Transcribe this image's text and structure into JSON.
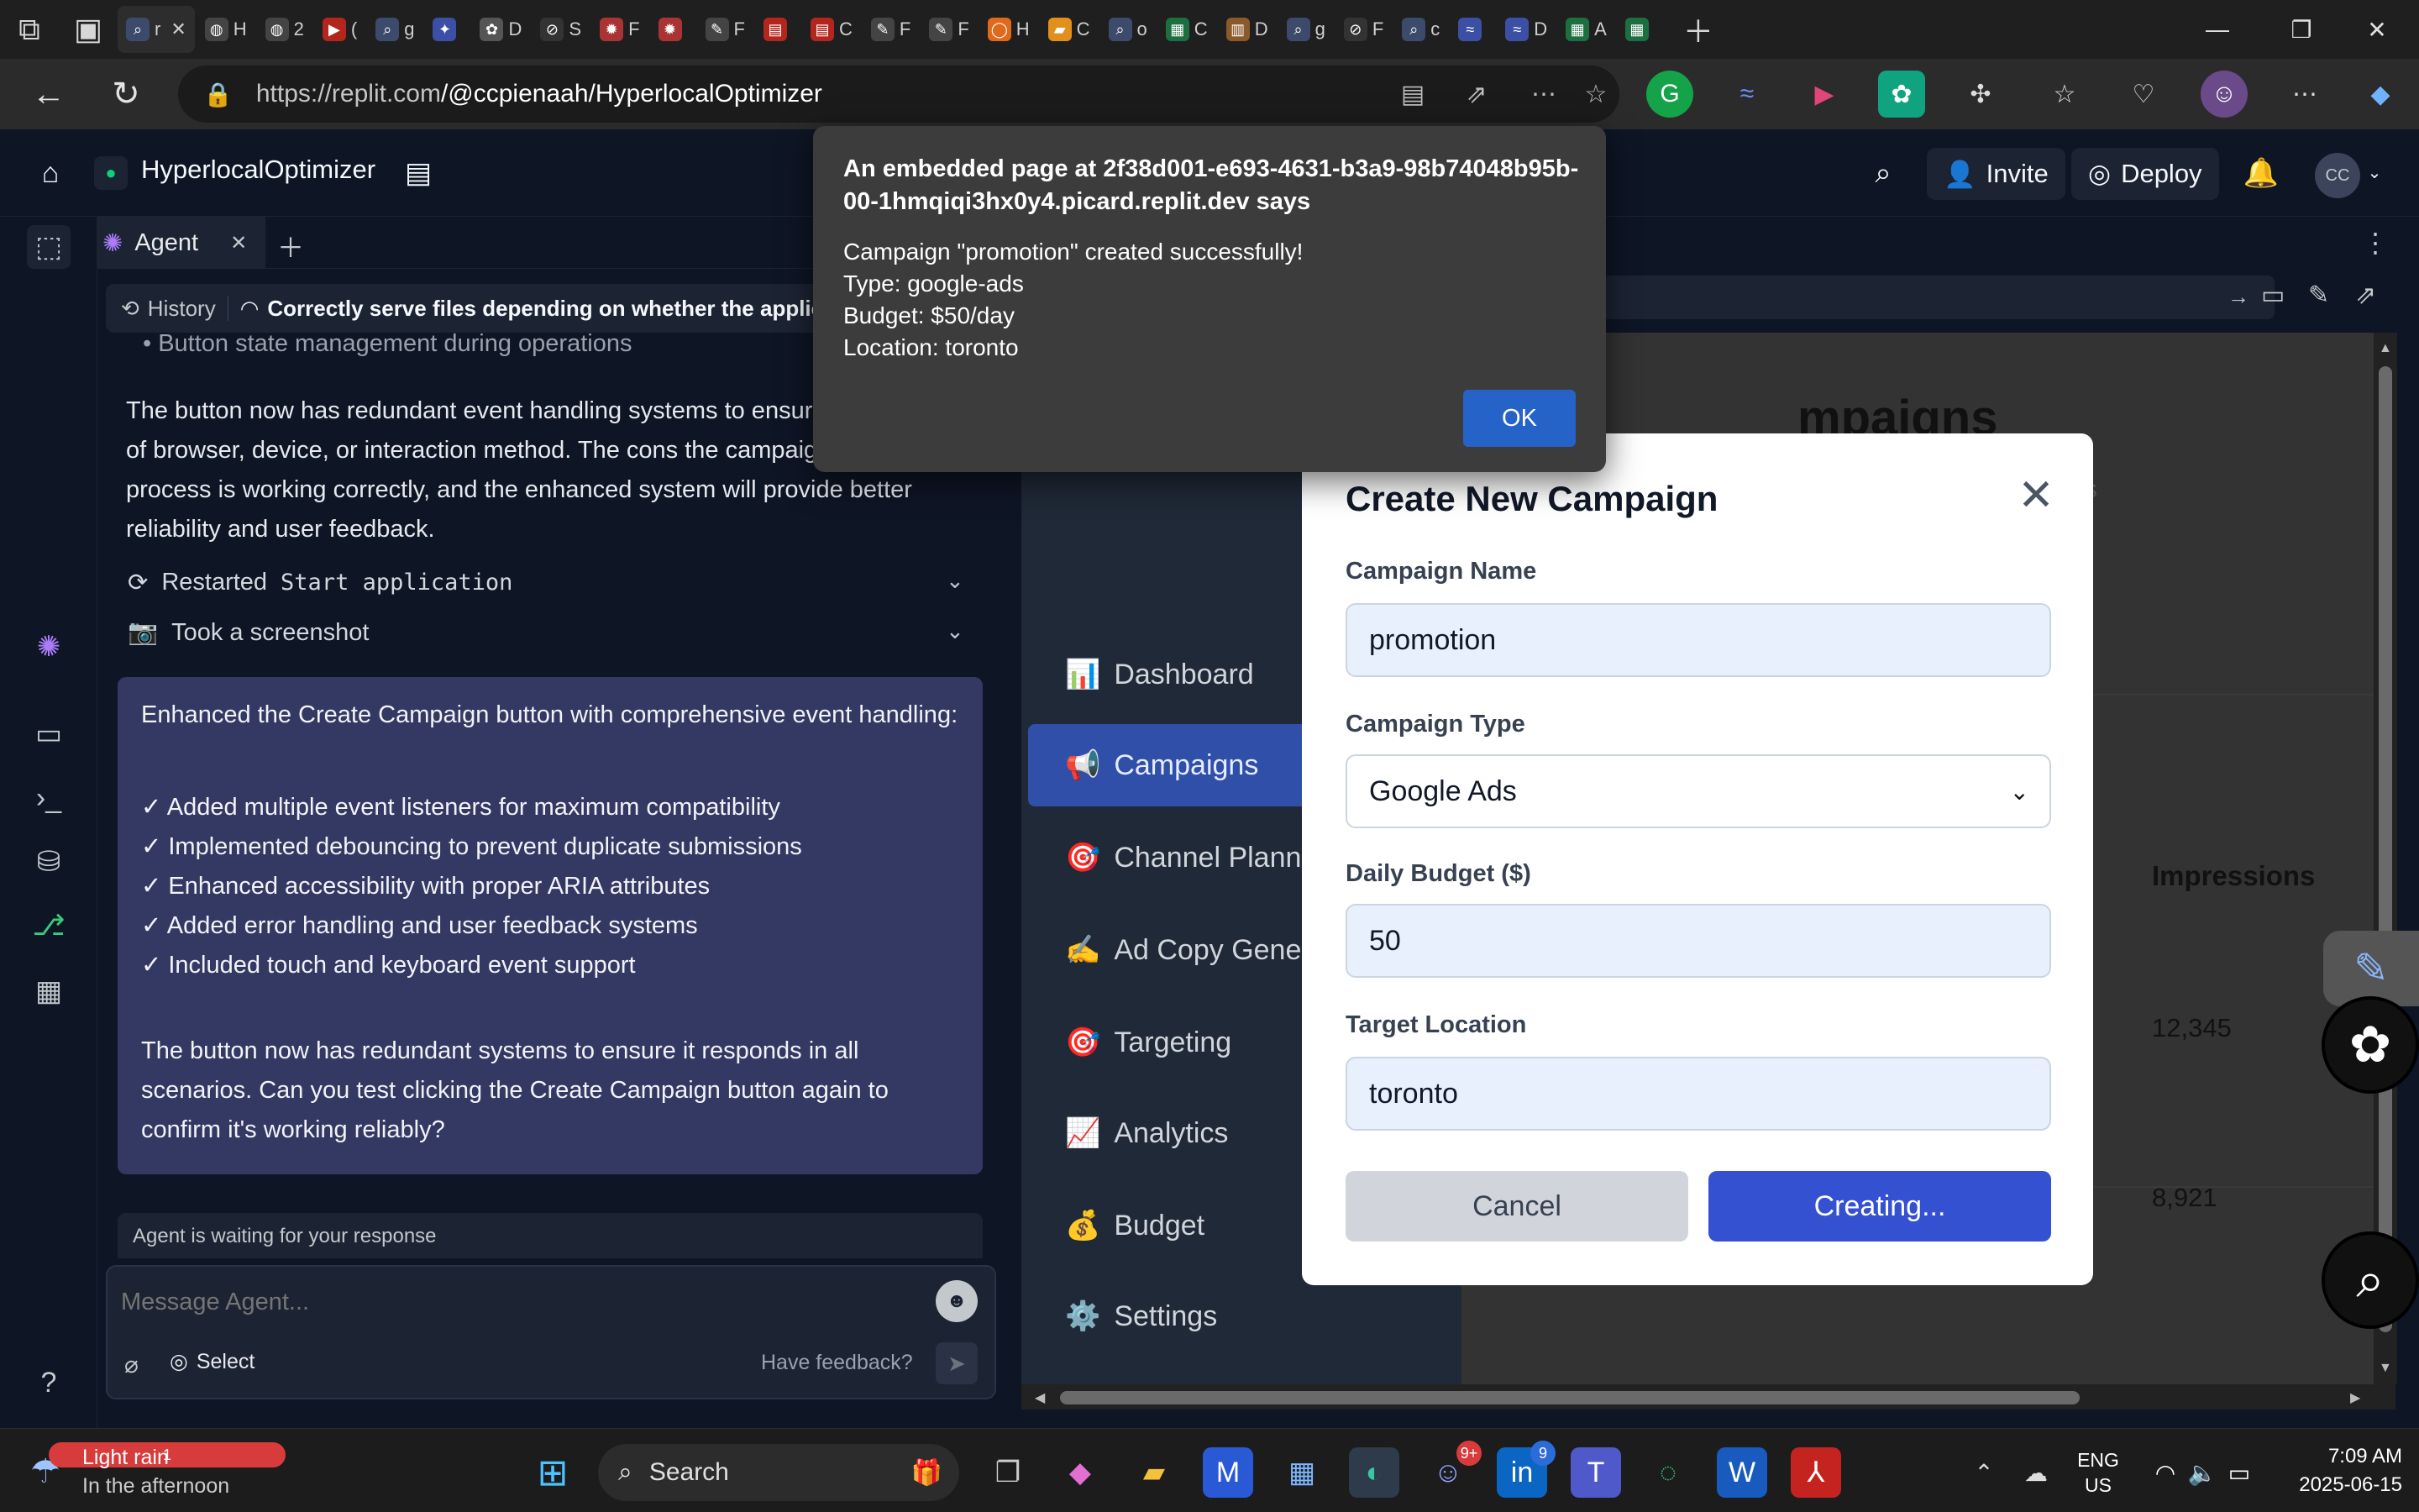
{
  "browser": {
    "tabs": [
      {
        "icon": "search-icon",
        "label": "r",
        "color": "#3c4a6b"
      },
      {
        "icon": "globe-icon",
        "label": "H",
        "color": "#444"
      },
      {
        "icon": "globe-icon",
        "label": "2",
        "color": "#444"
      },
      {
        "icon": "youtube-icon",
        "label": "(",
        "color": "#b3261e"
      },
      {
        "icon": "search-icon",
        "label": "g",
        "color": "#3c4a6b"
      },
      {
        "icon": "star-icon",
        "label": "",
        "color": "#3b4fa5"
      },
      {
        "icon": "openai-icon",
        "label": "D",
        "color": "#555"
      },
      {
        "icon": "slash-icon",
        "label": "S",
        "color": "#333"
      },
      {
        "icon": "gear-icon",
        "label": "F",
        "color": "#a33"
      },
      {
        "icon": "gear-icon",
        "label": "",
        "color": "#a33"
      },
      {
        "icon": "edit-icon",
        "label": "F",
        "color": "#444"
      },
      {
        "icon": "pdf-icon",
        "label": "",
        "color": "#b3261e"
      },
      {
        "icon": "pdf-icon",
        "label": "C",
        "color": "#b3261e"
      },
      {
        "icon": "edit-icon",
        "label": "F",
        "color": "#444"
      },
      {
        "icon": "edit-icon",
        "label": "F",
        "color": "#444"
      },
      {
        "icon": "circle-icon",
        "label": "H",
        "color": "#e06a1b"
      },
      {
        "icon": "book-icon",
        "label": "C",
        "color": "#e0901b"
      },
      {
        "icon": "search-icon",
        "label": "o",
        "color": "#3c4a6b"
      },
      {
        "icon": "sheet-icon",
        "label": "C",
        "color": "#1d6f42"
      },
      {
        "icon": "doc-icon",
        "label": "D",
        "color": "#8a5a2b"
      },
      {
        "icon": "search-icon",
        "label": "g",
        "color": "#3c4a6b"
      },
      {
        "icon": "slash-icon",
        "label": "F",
        "color": "#333"
      },
      {
        "icon": "search-icon",
        "label": "c",
        "color": "#3c4a6b"
      },
      {
        "icon": "wave-icon",
        "label": "",
        "color": "#3b4fa5"
      },
      {
        "icon": "wave-icon",
        "label": "D",
        "color": "#3b4fa5"
      },
      {
        "icon": "sheet-icon",
        "label": "A",
        "color": "#1d6f42"
      },
      {
        "icon": "sheet-icon",
        "label": "",
        "color": "#1d6f42"
      }
    ],
    "url_host": "https://replit.com",
    "url_path": "/@ccpienaah/HyperlocalOptimizer"
  },
  "replit": {
    "app_name": "HyperlocalOptimizer",
    "invite_label": "Invite",
    "deploy_label": "Deploy",
    "avatar_initials": "CC",
    "agent_tab_label": "Agent",
    "history_label": "History",
    "history_title": "Correctly serve files depending on whether the applicati",
    "partial_bullet": "• Button state management during operations",
    "para1": "The button now has redundant event handling systems to ensure regardless of browser, device, or interaction method. The cons the campaign creation process is working correctly, and the enhanced system will provide better reliability and user feedback.",
    "action1_prefix": "Restarted",
    "action1_code": "Start application",
    "action2": "Took a screenshot",
    "card_intro": "Enhanced the Create Campaign button with comprehensive event handling:",
    "card_items": [
      "✓ Added multiple event listeners for maximum compatibility",
      "✓ Implemented debouncing to prevent duplicate submissions",
      "✓ Enhanced accessibility with proper ARIA attributes",
      "✓ Added error handling and user feedback systems",
      "✓ Included touch and keyboard event support"
    ],
    "card_outro": "The button now has redundant systems to ensure it responds in all scenarios. Can you test clicking the Create Campaign button again to confirm it's working reliably?",
    "waiting": "Agent is waiting for your response",
    "message_placeholder": "Message Agent...",
    "select_label": "Select",
    "feedback_label": "Have feedback?"
  },
  "site": {
    "nav": [
      {
        "emoji": "📊",
        "label": "Dashboard",
        "active": false
      },
      {
        "emoji": "📢",
        "label": "Campaigns",
        "active": true
      },
      {
        "emoji": "🎯",
        "label": "Channel Planner",
        "active": false
      },
      {
        "emoji": "✍️",
        "label": "Ad Copy Genera",
        "active": false
      },
      {
        "emoji": "🎯",
        "label": "Targeting",
        "active": false
      },
      {
        "emoji": "📈",
        "label": "Analytics",
        "active": false
      },
      {
        "emoji": "💰",
        "label": "Budget",
        "active": false
      },
      {
        "emoji": "⚙️",
        "label": "Settings",
        "active": false
      }
    ],
    "page_heading_fragment": "mpaigns",
    "subheading_fragment": "igns",
    "column_header": "Impressions",
    "impressions": [
      "12,345",
      "8,921"
    ],
    "row_fragment": "n",
    "row_fragment_2": "2"
  },
  "modal": {
    "title": "Create New Campaign",
    "name_label": "Campaign Name",
    "name_value": "promotion",
    "type_label": "Campaign Type",
    "type_value": "Google Ads",
    "budget_label": "Daily Budget ($)",
    "budget_value": "50",
    "location_label": "Target Location",
    "location_value": "toronto",
    "cancel_label": "Cancel",
    "submit_label": "Creating..."
  },
  "alert": {
    "title": "An embedded page at 2f38d001-e693-4631-b3a9-98b74048b95b-00-1hmqiqi3hx0y4.picard.replit.dev says",
    "lines": [
      "Campaign \"promotion\" created successfully!",
      "Type: google-ads",
      "Budget: $50/day",
      "Location: toronto"
    ],
    "ok_label": "OK"
  },
  "taskbar": {
    "weather_badge": "1",
    "weather_title": "Light rain",
    "weather_sub": "In the afternoon",
    "search_label": "Search",
    "discord_badge": "9+",
    "linkedin_badge": "9",
    "lang_1": "ENG",
    "lang_2": "US",
    "time": "7:09 AM",
    "date": "2025-06-15"
  },
  "colors": {
    "replit_bg": "#0e1525",
    "agent_card": "#343963",
    "site_nav_active": "#2f4fa8",
    "submit_button": "#3451d1",
    "alert_ok": "#2563c9"
  }
}
